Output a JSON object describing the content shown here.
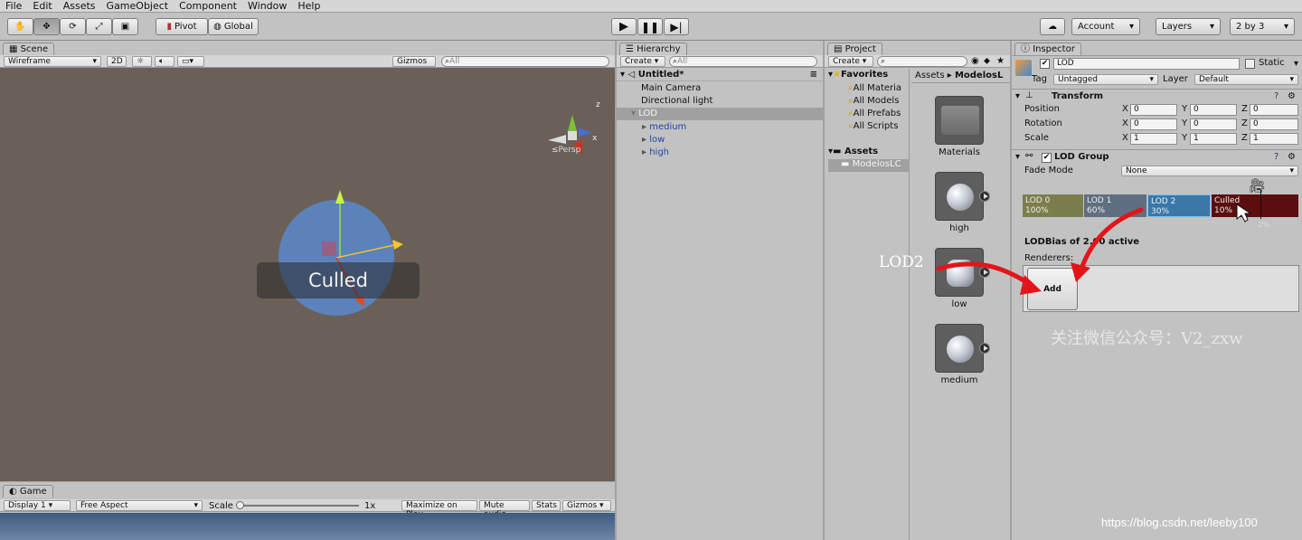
{
  "menu": [
    "File",
    "Edit",
    "Assets",
    "GameObject",
    "Component",
    "Window",
    "Help"
  ],
  "toolbar": {
    "pivot": "Pivot",
    "global": "Global",
    "account": "Account",
    "layers": "Layers",
    "layout": "2 by 3"
  },
  "scene": {
    "tab": "Scene",
    "render_mode": "Wireframe",
    "mode_2d": "2D",
    "gizmos": "Gizmos",
    "search_placeholder": "All",
    "persp": "Persp",
    "gizmo_x": "x",
    "gizmo_z": "z",
    "overlay": "Culled"
  },
  "game": {
    "tab": "Game",
    "display": "Display 1",
    "aspect": "Free Aspect",
    "scale_label": "Scale",
    "scale_value": "1x",
    "maximize": "Maximize on Play",
    "mute": "Mute audio",
    "stats": "Stats",
    "gizmos": "Gizmos"
  },
  "hierarchy": {
    "tab": "Hierarchy",
    "create": "Create",
    "search_placeholder": "All",
    "scene_name": "Untitled*",
    "items": [
      "Main Camera",
      "Directional light",
      "LOD"
    ],
    "children": [
      "medium",
      "low",
      "high"
    ]
  },
  "project": {
    "tab": "Project",
    "create": "Create",
    "favorites": "Favorites",
    "fav_items": [
      "All Materia",
      "All Models",
      "All Prefabs",
      "All Scripts"
    ],
    "assets": "Assets",
    "assets_child": "ModelosLC",
    "breadcrumb_root": "Assets",
    "breadcrumb_child": "ModelosL",
    "thumbs": [
      "Materials",
      "high",
      "low",
      "medium"
    ]
  },
  "inspector": {
    "tab": "Inspector",
    "object_name": "LOD",
    "static": "Static",
    "tag_label": "Tag",
    "tag_value": "Untagged",
    "layer_label": "Layer",
    "layer_value": "Default",
    "transform": "Transform",
    "position": "Position",
    "rotation": "Rotation",
    "scale": "Scale",
    "axis_x": "X",
    "axis_y": "Y",
    "axis_z": "Z",
    "pos": [
      "0",
      "0",
      "0"
    ],
    "rot": [
      "0",
      "0",
      "0"
    ],
    "scl": [
      "1",
      "1",
      "1"
    ],
    "lod_group": "LOD Group",
    "fade_mode": "Fade Mode",
    "fade_value": "None",
    "lod0": "LOD 0",
    "lod0_pct": "100%",
    "lod1": "LOD 1",
    "lod1_pct": "60%",
    "lod2": "LOD 2",
    "lod2_pct": "30%",
    "culled": "Culled",
    "culled_pct": "10%",
    "camera_pct": "2%",
    "lodbias": "LODBias of 2.00 active",
    "renderers": "Renderers:",
    "add": "Add"
  },
  "annotation": {
    "label": "LOD2",
    "watermark": "关注微信公众号：V2_zxw",
    "credit": "https://blog.csdn.net/leeby100"
  },
  "colors": {
    "scene_bg": "#6b6058",
    "lod0": "#7b7e4c",
    "lod1": "#5f6e80",
    "lod2": "#3a78a8",
    "culled": "#5b0e0e",
    "arrow": "#e3151a",
    "selection": "#a0a0a0"
  }
}
